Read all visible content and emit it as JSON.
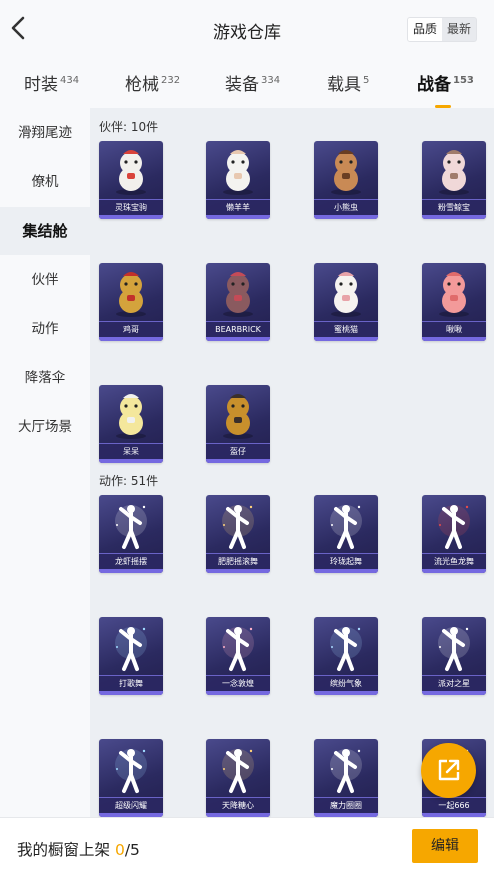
{
  "header": {
    "title": "游戏仓库",
    "sort_quality": "品质",
    "sort_latest": "最新"
  },
  "tabs": [
    {
      "label": "时装",
      "count": "434"
    },
    {
      "label": "枪械",
      "count": "232"
    },
    {
      "label": "装备",
      "count": "334"
    },
    {
      "label": "载具",
      "count": "5"
    },
    {
      "label": "战备",
      "count": "153"
    }
  ],
  "sidebar": [
    "滑翔尾迹",
    "僚机",
    "集结舱",
    "伙伴",
    "动作",
    "降落伞",
    "大厅场景"
  ],
  "companions": {
    "title": "伙伴: 10件",
    "items": [
      "灵珠宝驹",
      "懒羊羊",
      "小熊虫",
      "粉雪鲸宝",
      "鸡哥",
      "BEARBRICK",
      "蜜桃猫",
      "啾啾",
      "呆呆",
      "盔仔"
    ]
  },
  "emotes": {
    "title": "动作: 51件",
    "items": [
      "龙虾摇摆",
      "肥肥摇滚舞",
      "玲珑起舞",
      "流光鱼龙舞",
      "打歌舞",
      "一念敦煌",
      "缤纷气象",
      "派对之星",
      "超级闪耀",
      "天降糖心",
      "魔力圈圈",
      "一起666"
    ]
  },
  "bottom": {
    "prefix": "我的橱窗上架 ",
    "current": "0",
    "total": "/5",
    "edit_label": "编辑"
  },
  "colors": {
    "accent": "#f6a700",
    "card_bg": "#2b2a60",
    "card_bar": "#7569e0"
  },
  "icons": {
    "back": "chevron-left-icon",
    "share": "share-out-icon"
  }
}
